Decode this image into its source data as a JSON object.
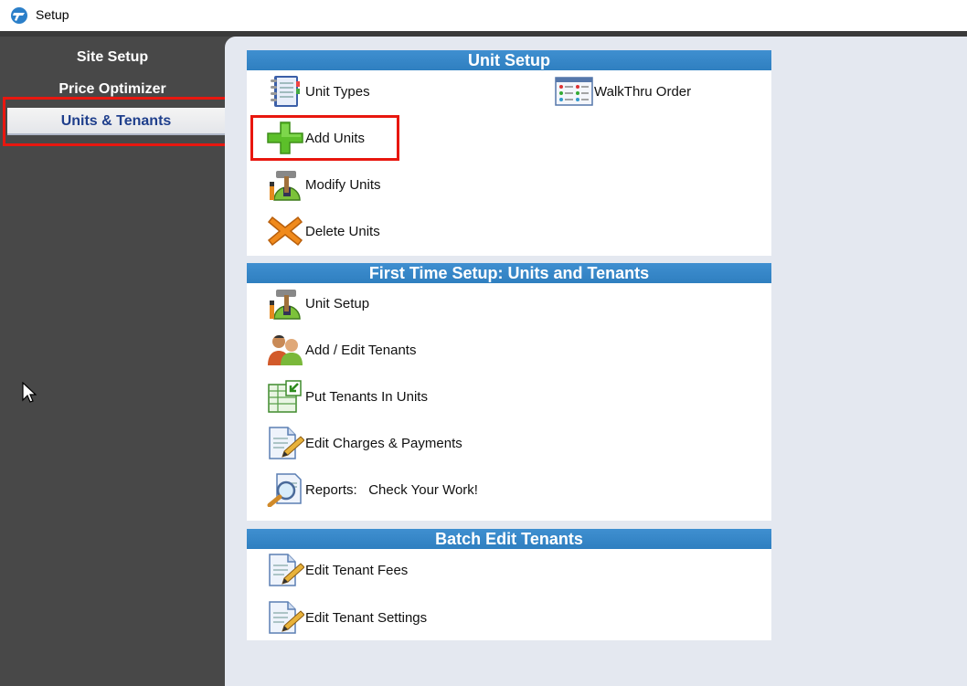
{
  "window": {
    "title": "Setup",
    "icon": "app-logo-icon"
  },
  "sidebar": {
    "items": [
      {
        "label": "Site Setup",
        "active": false
      },
      {
        "label": "Price Optimizer",
        "active": false
      },
      {
        "label": "Units & Tenants",
        "active": true
      }
    ]
  },
  "unit_setup": {
    "header": "Unit Setup",
    "items": [
      {
        "label": "Unit Types",
        "icon": "notebook-icon"
      },
      {
        "label": "WalkThru Order",
        "icon": "grid-list-icon"
      },
      {
        "label": "Add Units",
        "icon": "green-plus-icon"
      },
      {
        "label": "Modify Units",
        "icon": "construction-hammer-icon"
      },
      {
        "label": "Delete Units",
        "icon": "orange-x-icon"
      }
    ]
  },
  "first_time": {
    "header": "First Time Setup:  Units and Tenants",
    "items": [
      {
        "label": "Unit Setup",
        "icon": "construction-hammer-icon"
      },
      {
        "label": "Add / Edit Tenants",
        "icon": "people-icon"
      },
      {
        "label": "Put Tenants In Units",
        "icon": "spreadsheet-arrow-icon"
      },
      {
        "label": "Edit Charges & Payments",
        "icon": "document-pencil-icon"
      },
      {
        "label": "Reports:   Check Your Work!",
        "icon": "magnifier-document-icon"
      }
    ]
  },
  "batch_edit": {
    "header": "Batch Edit Tenants",
    "items": [
      {
        "label": "Edit Tenant Fees",
        "icon": "document-pencil-icon"
      },
      {
        "label": "Edit Tenant Settings",
        "icon": "document-pencil-icon"
      }
    ]
  },
  "colors": {
    "accent": "#2f7fc0",
    "highlight": "#e8170f",
    "sidebar": "#484848",
    "workspace": "#e4e8f0"
  }
}
